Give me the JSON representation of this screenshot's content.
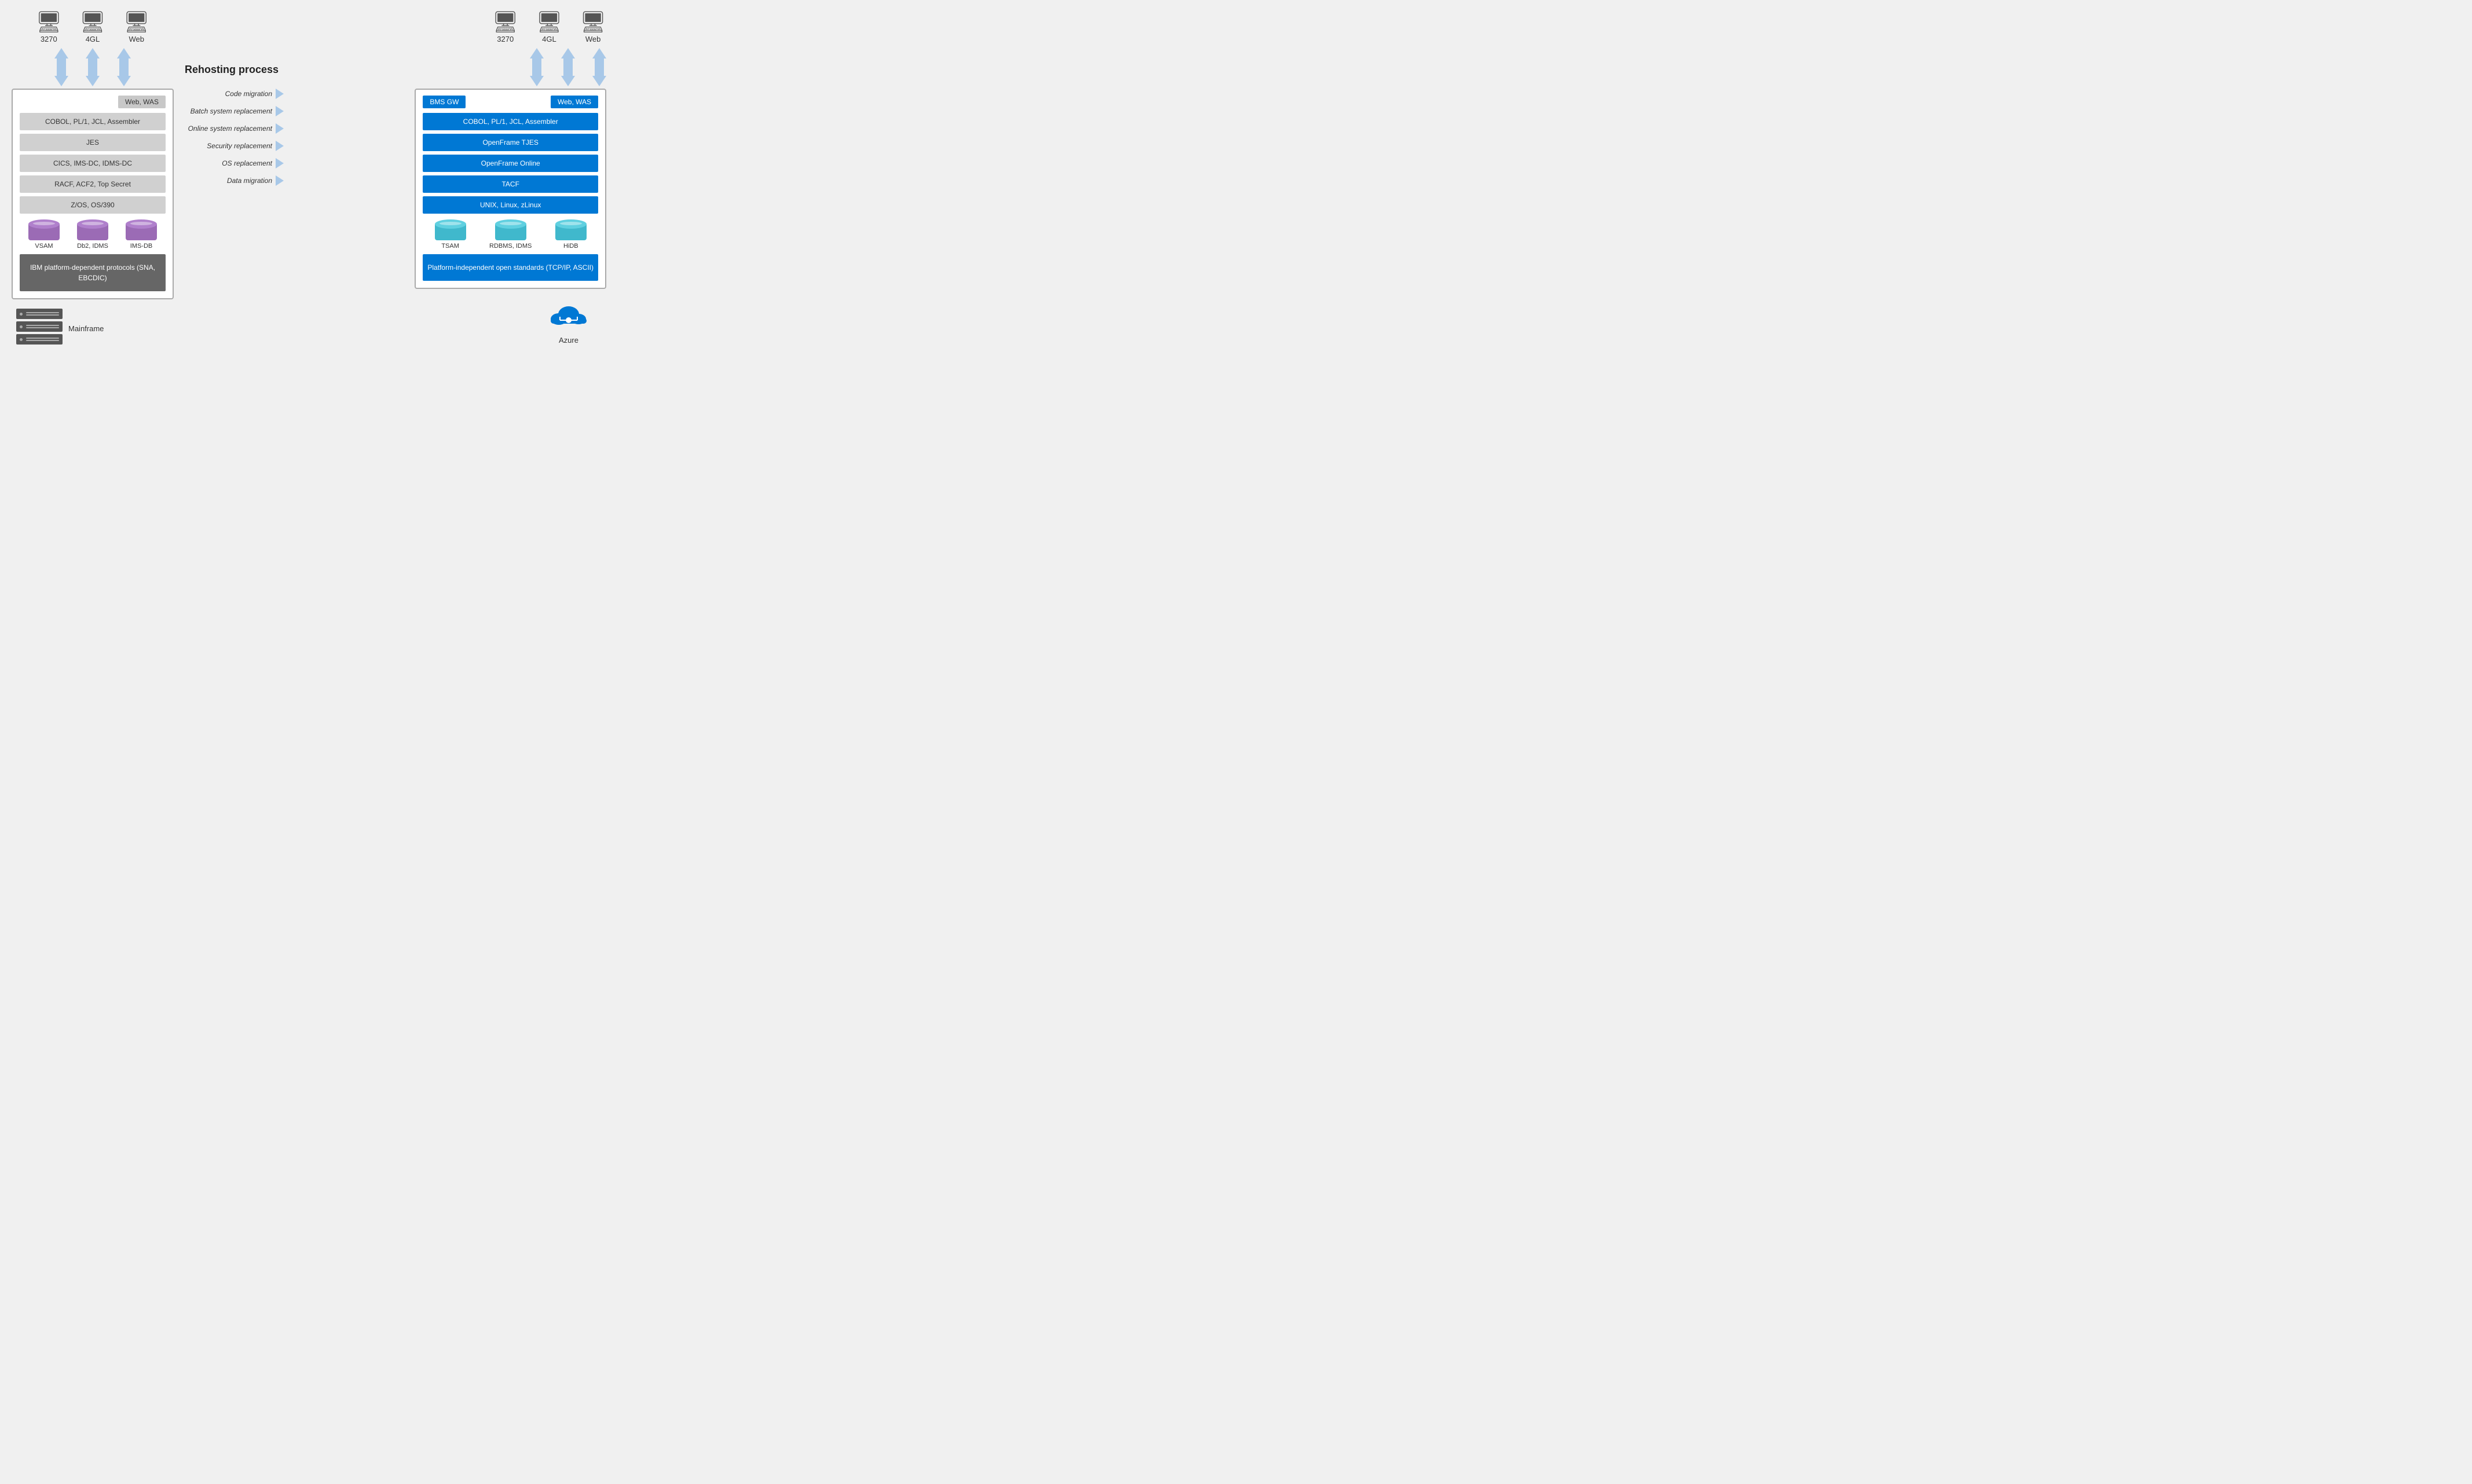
{
  "left": {
    "monitors": [
      {
        "label": "3270"
      },
      {
        "label": "4GL"
      },
      {
        "label": "Web"
      }
    ],
    "badge": "Web, WAS",
    "bars": [
      {
        "text": "COBOL, PL/1, JCL, Assembler",
        "style": "light"
      },
      {
        "text": "JES",
        "style": "light"
      },
      {
        "text": "CICS, IMS-DC, IDMS-DC",
        "style": "light"
      },
      {
        "text": "RACF, ACF2, Top Secret",
        "style": "light"
      },
      {
        "text": "Z/OS, OS/390",
        "style": "light"
      }
    ],
    "databases": [
      {
        "label": "VSAM",
        "color": "purple"
      },
      {
        "label": "Db2, IDMS",
        "color": "purple"
      },
      {
        "label": "IMS-DB",
        "color": "purple"
      }
    ],
    "ibm_box": "IBM platform-dependent\nprotocols (SNA, EBCDIC)"
  },
  "middle": {
    "title": "Rehosting process",
    "processes": [
      {
        "label": "Code migration"
      },
      {
        "label": "Batch system replacement"
      },
      {
        "label": "Online system replacement"
      },
      {
        "label": "Security replacement"
      },
      {
        "label": "OS replacement"
      },
      {
        "label": "Data migration"
      }
    ]
  },
  "right": {
    "monitors": [
      {
        "label": "3270"
      },
      {
        "label": "4GL"
      },
      {
        "label": "Web"
      }
    ],
    "badge_left": "BMS GW",
    "badge_right": "Web, WAS",
    "bars": [
      {
        "text": "COBOL, PL/1, JCL, Assembler",
        "style": "blue"
      },
      {
        "text": "OpenFrame TJES",
        "style": "blue"
      },
      {
        "text": "OpenFrame Online",
        "style": "blue"
      },
      {
        "text": "TACF",
        "style": "blue"
      },
      {
        "text": "UNIX, Linux, zLinux",
        "style": "blue"
      }
    ],
    "databases": [
      {
        "label": "TSAM",
        "color": "cyan"
      },
      {
        "label": "RDBMS, IDMS",
        "color": "cyan"
      },
      {
        "label": "HiDB",
        "color": "cyan"
      }
    ],
    "platform_box": "Platform-independent\nopen standards (TCP/IP, ASCII)"
  },
  "bottom": {
    "mainframe_label": "Mainframe",
    "azure_label": "Azure"
  }
}
